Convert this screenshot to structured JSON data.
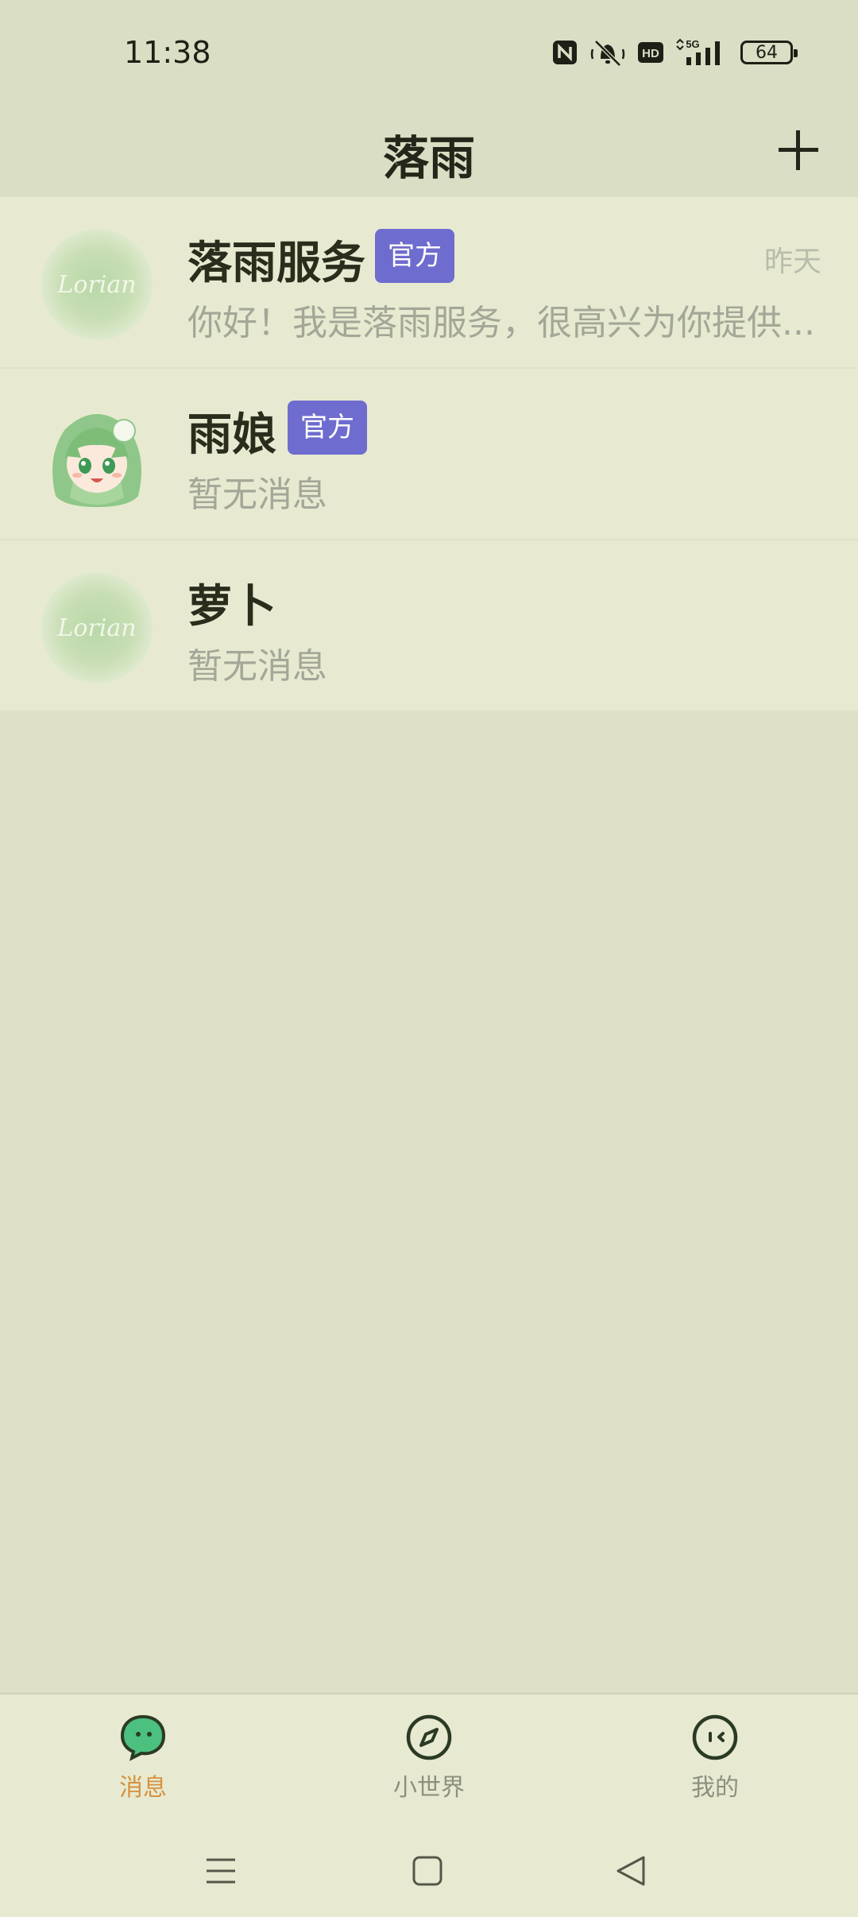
{
  "status_bar": {
    "time": "11:38",
    "network_label": "5G",
    "hd_label": "HD",
    "battery_level": "64",
    "icons": [
      "nfc-icon",
      "bell-muted-icon",
      "hd-icon",
      "signal-5g-icon",
      "battery-icon"
    ]
  },
  "header": {
    "title": "落雨",
    "add_icon": "plus-icon"
  },
  "conversations": [
    {
      "name": "落雨服务",
      "badge": "官方",
      "time": "昨天",
      "preview": "你好！我是落雨服务，很高兴为你提供...",
      "avatar_text": "Lorian"
    },
    {
      "name": "雨娘",
      "badge": "官方",
      "time": "",
      "preview": "暂无消息",
      "avatar_text": ""
    },
    {
      "name": "萝卜",
      "badge": "",
      "time": "",
      "preview": "暂无消息",
      "avatar_text": "Lorian"
    }
  ],
  "bottom_nav": {
    "items": [
      {
        "label": "消息",
        "icon": "chat-bubble-icon",
        "active": true
      },
      {
        "label": "小世界",
        "icon": "compass-icon",
        "active": false
      },
      {
        "label": "我的",
        "icon": "face-icon",
        "active": false
      }
    ]
  },
  "system_nav": {
    "icons": [
      "menu-icon",
      "home-icon",
      "back-icon"
    ]
  },
  "colors": {
    "background": "#dde0c6",
    "list_item": "#e7ead0",
    "badge": "#6f6ccf",
    "active_tab": "#d7913f",
    "muted_text": "#a4a797"
  }
}
